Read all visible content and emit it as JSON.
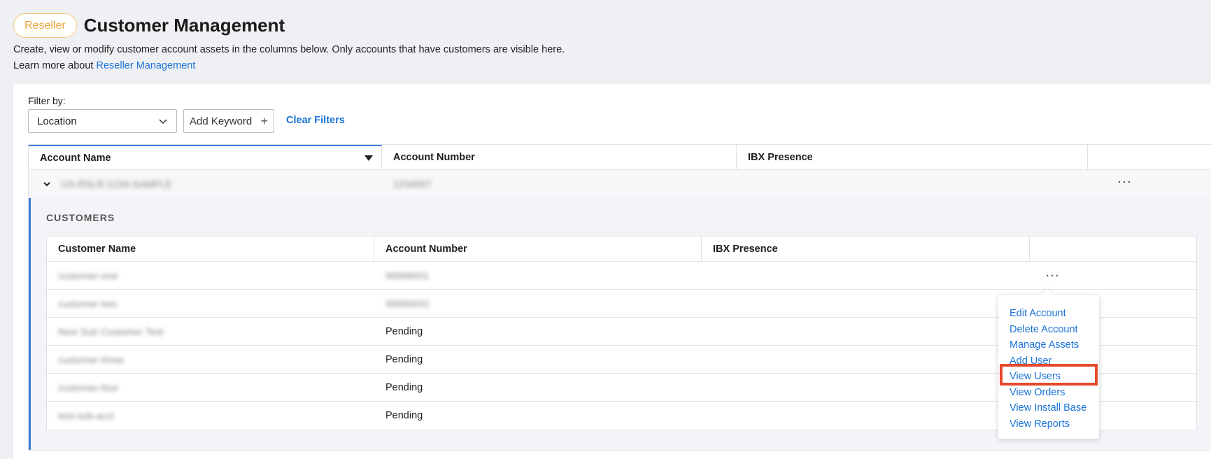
{
  "header": {
    "badge": "Reseller",
    "title": "Customer Management",
    "description": "Create, view or modify customer account assets in the columns below. Only accounts that have customers are visible here.",
    "learn_more_prefix": "Learn more about ",
    "learn_more_link": "Reseller Management"
  },
  "filters": {
    "label": "Filter by:",
    "location": "Location",
    "add_keyword": "Add Keyword",
    "clear": "Clear Filters"
  },
  "accounts_table": {
    "columns": [
      "Account Name",
      "Account Number",
      "IBX Presence"
    ],
    "row": {
      "name": "US-RSLR-1234-SAMPLE",
      "number": "1234567"
    }
  },
  "customers": {
    "section_label": "CUSTOMERS",
    "columns": [
      "Customer Name",
      "Account Number",
      "IBX Presence"
    ],
    "rows": [
      {
        "name": "customer-one",
        "number": "99999001",
        "blurred": true
      },
      {
        "name": "customer-two",
        "number": "99999002",
        "blurred": true
      },
      {
        "name": "New Sub Customer Test",
        "number": "Pending",
        "blurred": false
      },
      {
        "name": "customer-three",
        "number": "Pending",
        "blurred": false
      },
      {
        "name": "customer-four",
        "number": "Pending",
        "blurred": false
      },
      {
        "name": "test-sub-acct",
        "number": "Pending",
        "blurred": false
      }
    ]
  },
  "context_menu": {
    "items": [
      "Edit Account",
      "Delete Account",
      "Manage Assets",
      "Add User",
      "View Users",
      "View Orders",
      "View Install Base",
      "View Reports"
    ],
    "highlighted": "View Users",
    "highlight_color": "#e5482a"
  },
  "more_label": "···"
}
